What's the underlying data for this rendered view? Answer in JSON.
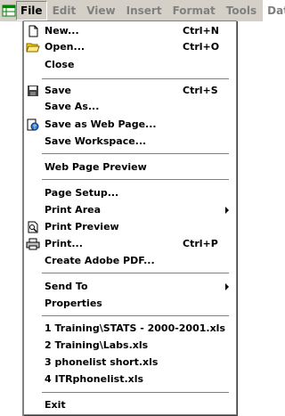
{
  "menubar": {
    "items": [
      "File",
      "Edit",
      "View",
      "Insert",
      "Format",
      "Tools",
      "Data"
    ]
  },
  "file_menu": {
    "new": {
      "label": "New...",
      "shortcut": "Ctrl+N"
    },
    "open": {
      "label": "Open...",
      "shortcut": "Ctrl+O"
    },
    "close": {
      "label": "Close"
    },
    "save": {
      "label": "Save",
      "shortcut": "Ctrl+S"
    },
    "save_as": {
      "label": "Save As..."
    },
    "save_web": {
      "label": "Save as Web Page..."
    },
    "save_workspace": {
      "label": "Save Workspace..."
    },
    "web_preview": {
      "label": "Web Page Preview"
    },
    "page_setup": {
      "label": "Page Setup..."
    },
    "print_area": {
      "label": "Print Area"
    },
    "print_preview": {
      "label": "Print Preview"
    },
    "print": {
      "label": "Print...",
      "shortcut": "Ctrl+P"
    },
    "adobe_pdf": {
      "label": "Create Adobe PDF..."
    },
    "send_to": {
      "label": "Send To"
    },
    "properties": {
      "label": "Properties"
    },
    "recent": [
      "1 Training\\STATS - 2000-2001.xls",
      "2 Training\\Labs.xls",
      "3 phonelist short.xls",
      "4 ITRphonelist.xls"
    ],
    "exit": {
      "label": "Exit"
    }
  }
}
